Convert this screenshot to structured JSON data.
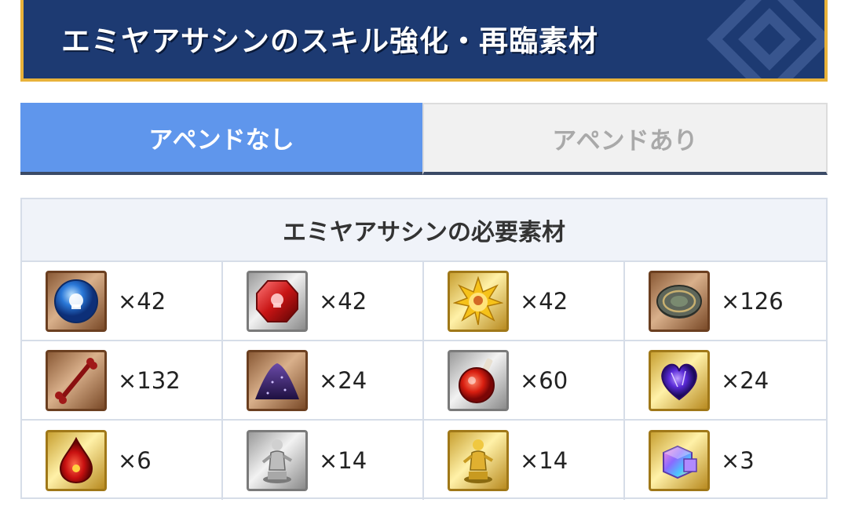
{
  "banner": {
    "title": "エミヤアサシンのスキル強化・再臨素材"
  },
  "tabs": [
    {
      "label": "アペンドなし",
      "active": true
    },
    {
      "label": "アペンドあり",
      "active": false
    }
  ],
  "panel": {
    "title": "エミヤアサシンの必要素材"
  },
  "materials": [
    {
      "icon": "blue-gem-icon",
      "qty": "×42"
    },
    {
      "icon": "red-gem-icon",
      "qty": "×42"
    },
    {
      "icon": "gold-gem-icon",
      "qty": "×42"
    },
    {
      "icon": "ancient-coin-icon",
      "qty": "×126"
    },
    {
      "icon": "bone-icon",
      "qty": "×132"
    },
    {
      "icon": "purple-powder-icon",
      "qty": "×24"
    },
    {
      "icon": "red-flask-icon",
      "qty": "×60"
    },
    {
      "icon": "purple-heart-icon",
      "qty": "×24"
    },
    {
      "icon": "red-drop-icon",
      "qty": "×6"
    },
    {
      "icon": "silver-statue-icon",
      "qty": "×14"
    },
    {
      "icon": "gold-statue-icon",
      "qty": "×14"
    },
    {
      "icon": "prism-cube-icon",
      "qty": "×3"
    }
  ],
  "colors": {
    "banner": "#1d3a72",
    "banner_border": "#e8b23a",
    "tab_active": "#5f96ec"
  }
}
